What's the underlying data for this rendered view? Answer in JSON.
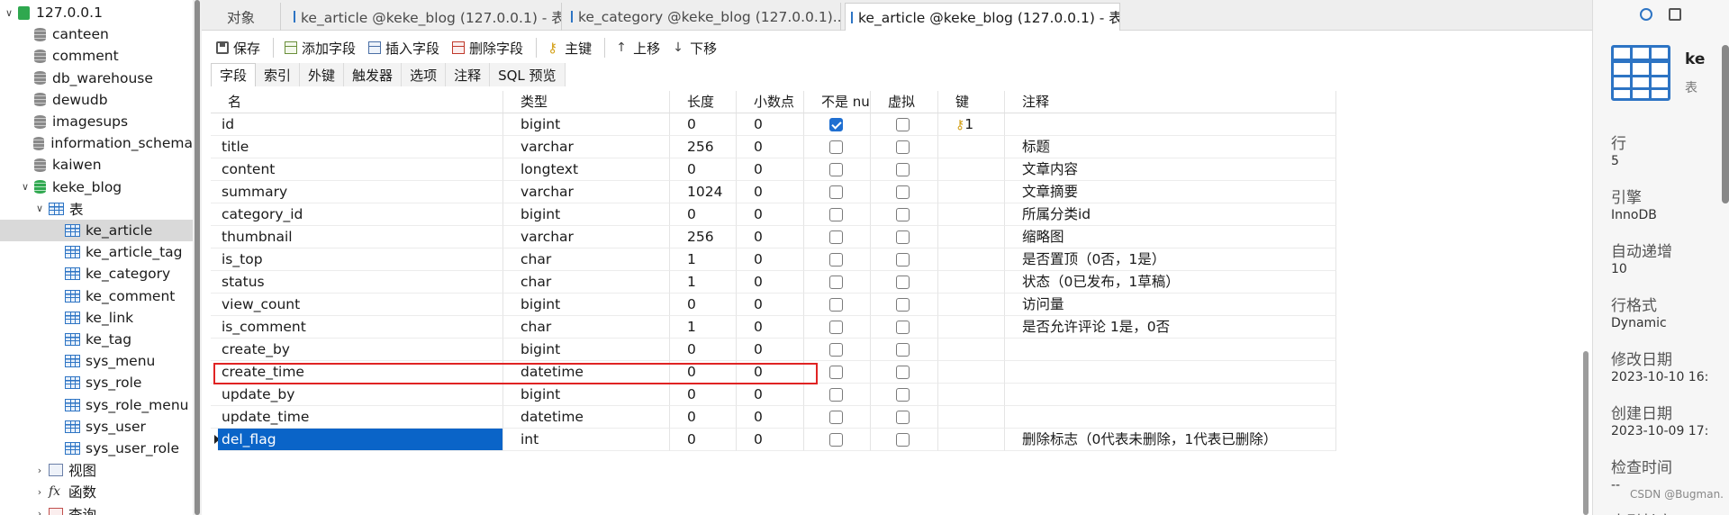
{
  "tree": {
    "connection": "127.0.0.1",
    "databases": [
      "canteen",
      "comment",
      "db_warehouse",
      "dewudb",
      "imagesups",
      "information_schema",
      "kaiwen",
      "keke_blog"
    ],
    "tables_label": "表",
    "tables": [
      "ke_article",
      "ke_article_tag",
      "ke_category",
      "ke_comment",
      "ke_link",
      "ke_tag",
      "sys_menu",
      "sys_role",
      "sys_role_menu",
      "sys_user",
      "sys_user_role"
    ],
    "selected_table": "ke_article",
    "views_label": "视图",
    "functions_label": "函数",
    "queries_label": "查询"
  },
  "tabs": [
    {
      "label": "对象"
    },
    {
      "label": "ke_article @keke_blog (127.0.0.1) - 表"
    },
    {
      "label": "ke_category @keke_blog (127.0.0.1)..."
    },
    {
      "label": "ke_article @keke_blog (127.0.0.1) - 表"
    }
  ],
  "toolbar": {
    "save": "保存",
    "add_field": "添加字段",
    "insert_field": "插入字段",
    "delete_field": "删除字段",
    "primary_key": "主键",
    "move_up": "上移",
    "move_down": "下移"
  },
  "subtabs": [
    "字段",
    "索引",
    "外键",
    "触发器",
    "选项",
    "注释",
    "SQL 预览"
  ],
  "grid": {
    "headers": [
      "名",
      "类型",
      "长度",
      "小数点",
      "不是 null",
      "虚拟",
      "键",
      "注释"
    ],
    "rows": [
      {
        "name": "id",
        "type": "bigint",
        "length": "0",
        "decimals": "0",
        "not_null": true,
        "virtual": false,
        "key": "1",
        "comment": ""
      },
      {
        "name": "title",
        "type": "varchar",
        "length": "256",
        "decimals": "0",
        "not_null": false,
        "virtual": false,
        "key": "",
        "comment": "标题"
      },
      {
        "name": "content",
        "type": "longtext",
        "length": "0",
        "decimals": "0",
        "not_null": false,
        "virtual": false,
        "key": "",
        "comment": "文章内容"
      },
      {
        "name": "summary",
        "type": "varchar",
        "length": "1024",
        "decimals": "0",
        "not_null": false,
        "virtual": false,
        "key": "",
        "comment": "文章摘要"
      },
      {
        "name": "category_id",
        "type": "bigint",
        "length": "0",
        "decimals": "0",
        "not_null": false,
        "virtual": false,
        "key": "",
        "comment": "所属分类id"
      },
      {
        "name": "thumbnail",
        "type": "varchar",
        "length": "256",
        "decimals": "0",
        "not_null": false,
        "virtual": false,
        "key": "",
        "comment": "缩略图"
      },
      {
        "name": "is_top",
        "type": "char",
        "length": "1",
        "decimals": "0",
        "not_null": false,
        "virtual": false,
        "key": "",
        "comment": "是否置顶（0否，1是）"
      },
      {
        "name": "status",
        "type": "char",
        "length": "1",
        "decimals": "0",
        "not_null": false,
        "virtual": false,
        "key": "",
        "comment": "状态（0已发布，1草稿）"
      },
      {
        "name": "view_count",
        "type": "bigint",
        "length": "0",
        "decimals": "0",
        "not_null": false,
        "virtual": false,
        "key": "",
        "comment": "访问量"
      },
      {
        "name": "is_comment",
        "type": "char",
        "length": "1",
        "decimals": "0",
        "not_null": false,
        "virtual": false,
        "key": "",
        "comment": "是否允许评论 1是，0否"
      },
      {
        "name": "create_by",
        "type": "bigint",
        "length": "0",
        "decimals": "0",
        "not_null": false,
        "virtual": false,
        "key": "",
        "comment": ""
      },
      {
        "name": "create_time",
        "type": "datetime",
        "length": "0",
        "decimals": "0",
        "not_null": false,
        "virtual": false,
        "key": "",
        "comment": ""
      },
      {
        "name": "update_by",
        "type": "bigint",
        "length": "0",
        "decimals": "0",
        "not_null": false,
        "virtual": false,
        "key": "",
        "comment": ""
      },
      {
        "name": "update_time",
        "type": "datetime",
        "length": "0",
        "decimals": "0",
        "not_null": false,
        "virtual": false,
        "key": "",
        "comment": ""
      },
      {
        "name": "del_flag",
        "type": "int",
        "length": "0",
        "decimals": "0",
        "not_null": false,
        "virtual": false,
        "key": "",
        "comment": "删除标志（0代表未删除，1代表已删除）"
      }
    ],
    "selected_row": 14,
    "highlighted_row": 11
  },
  "info": {
    "title": "ke",
    "subtitle": "表",
    "fields": [
      {
        "label": "行",
        "value": "5"
      },
      {
        "label": "引擎",
        "value": "InnoDB"
      },
      {
        "label": "自动递增",
        "value": "10"
      },
      {
        "label": "行格式",
        "value": "Dynamic"
      },
      {
        "label": "修改日期",
        "value": "2023-10-10 16:"
      },
      {
        "label": "创建日期",
        "value": "2023-10-09 17:"
      },
      {
        "label": "检查时间",
        "value": "--"
      },
      {
        "label": "索引长度",
        "value": ""
      }
    ],
    "watermark": "CSDN @Bugman."
  },
  "colors": {
    "accent": "#2d74c4",
    "selection": "#0a64c8",
    "highlight_box": "#e02323",
    "db_green": "#2fa84f"
  }
}
